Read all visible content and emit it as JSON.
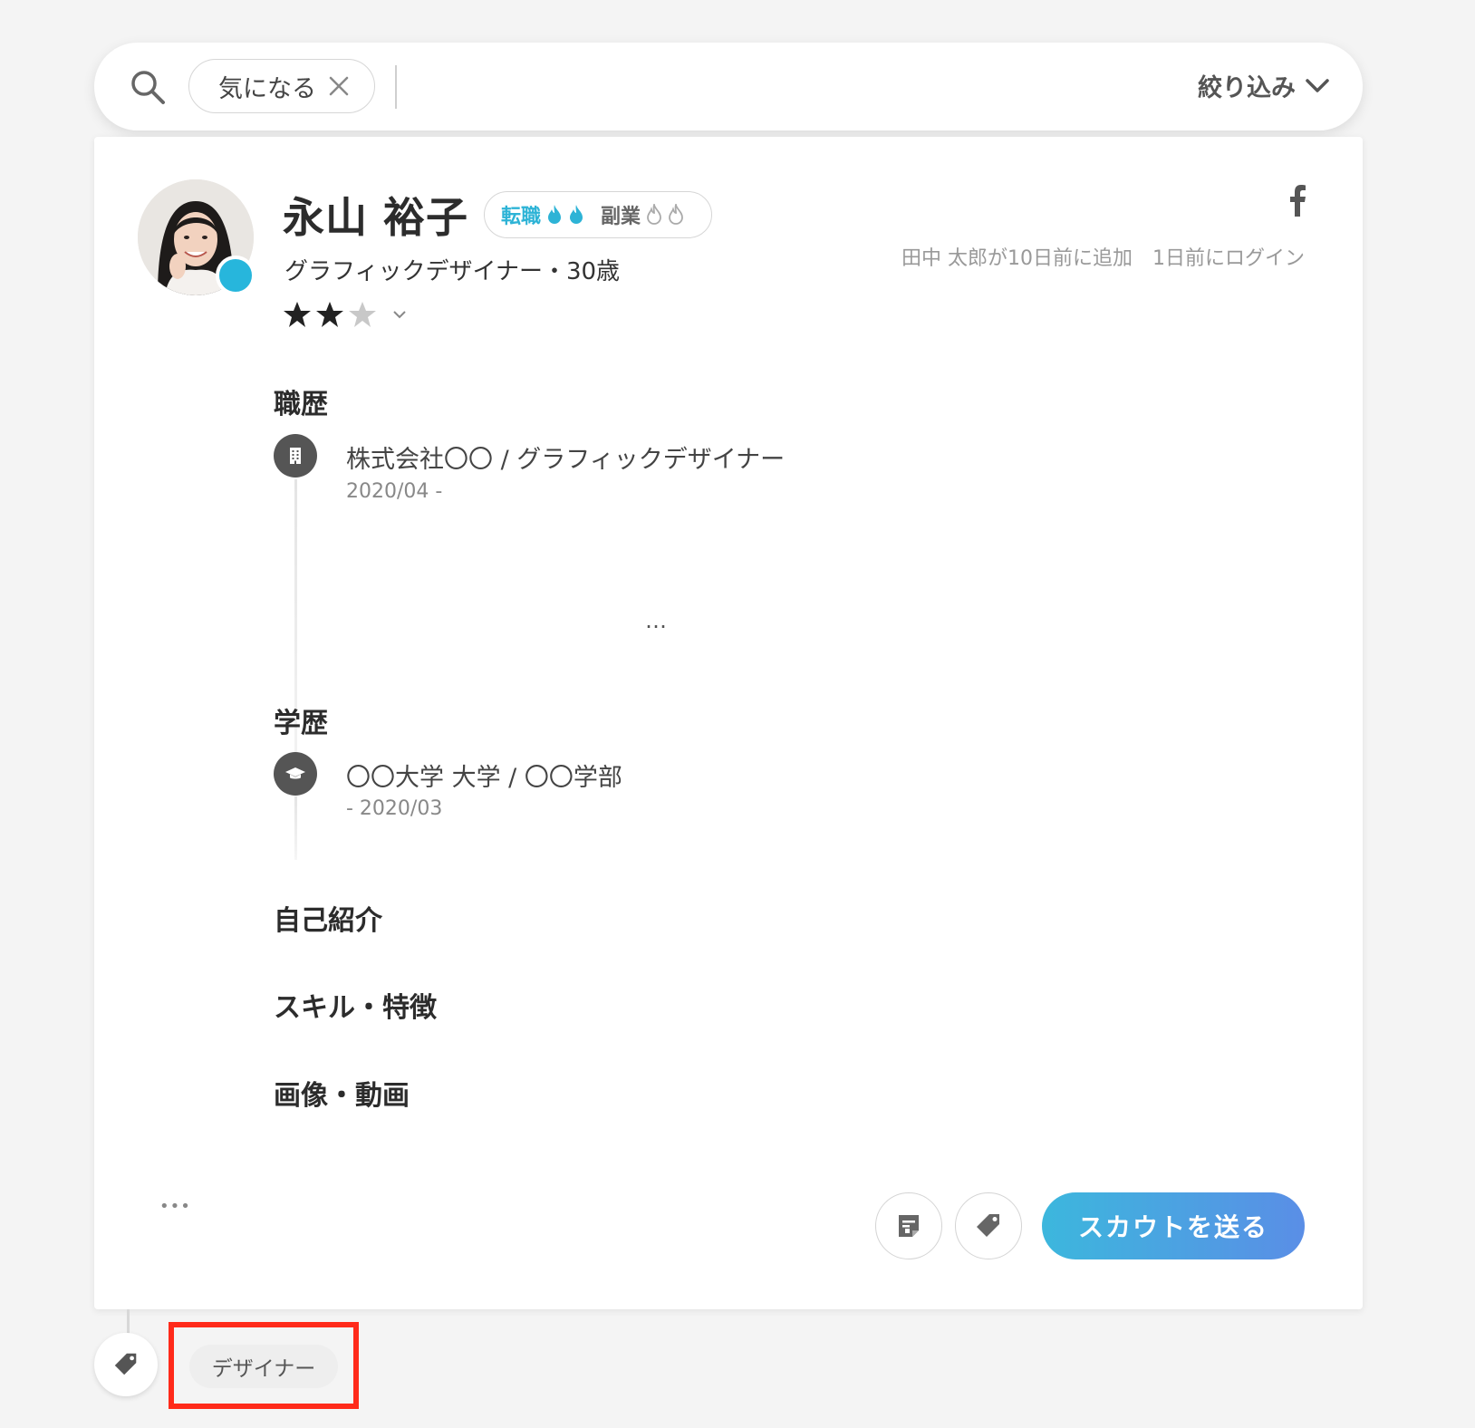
{
  "search": {
    "chip_label": "気になる",
    "input_placeholder": "",
    "filter_label": "絞り込み"
  },
  "profile": {
    "name": "永山 裕子",
    "intent_job_change": "転職",
    "intent_side_job": "副業",
    "subtitle": "グラフィックデザイナー・30歳",
    "rating": 2,
    "rating_max": 3,
    "meta": "田中 太郎が10日前に追加　1日前にログイン",
    "online_color": "#27b6dc"
  },
  "sections": {
    "career_title": "職歴",
    "career": [
      {
        "title": "株式会社〇〇 / グラフィックデザイナー",
        "date": "2020/04 -"
      }
    ],
    "career_more": "…",
    "education_title": "学歴",
    "education": [
      {
        "title": "〇〇大学 大学 / 〇〇学部",
        "date": "- 2020/03"
      }
    ],
    "intro_title": "自己紹介",
    "skills_title": "スキル・特徴",
    "media_title": "画像・動画"
  },
  "actions": {
    "more": "•••",
    "scout_label": "スカウトを送る",
    "accent_gradient": [
      "#3cb7dd",
      "#5a8ee6"
    ]
  },
  "tags": {
    "items": [
      "デザイナー"
    ],
    "highlight_color": "#ff2a1a"
  }
}
